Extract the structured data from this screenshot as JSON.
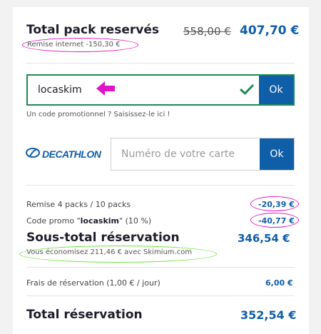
{
  "summary": {
    "title": "Total pack reservés",
    "price_old": "558,00 €",
    "price_new": "407,70 €",
    "remise_internet": "Remise internet -150,30 €"
  },
  "promo": {
    "value": "locaskim",
    "ok_label": "Ok",
    "hint": "Un code promotionnel ? Saisissez-le ici !"
  },
  "decathlon": {
    "logo_text": "DECATHLON",
    "placeholder": "Numéro de votre carte",
    "ok_label": "Ok"
  },
  "details": {
    "remise_packs_label": "Remise 4 packs / 10 packs",
    "remise_packs_value": "-20,39 €",
    "code_promo_prefix": "Code promo \"",
    "code_promo_code": "locaskim",
    "code_promo_suffix": "\" (10 %)",
    "code_promo_value": "-40,77 €",
    "sous_total_label": "Sous-total réservation",
    "sous_total_value": "346,54 €",
    "economie": "Vous économisez 211,46 € avec Skimium.com",
    "frais_label": "Frais de réservation (1,00 € / jour)",
    "frais_value": "6,00 €",
    "total_label": "Total réservation",
    "total_value": "352,54 €"
  },
  "colors": {
    "accent": "#0f5ea8",
    "valid": "#1f8a52",
    "annotation_magenta": "#e015c8",
    "annotation_green": "#6fe33a"
  },
  "icons": {
    "check": "check-icon",
    "arrow": "arrow-left-icon",
    "decathlon": "decathlon-logo-icon"
  }
}
